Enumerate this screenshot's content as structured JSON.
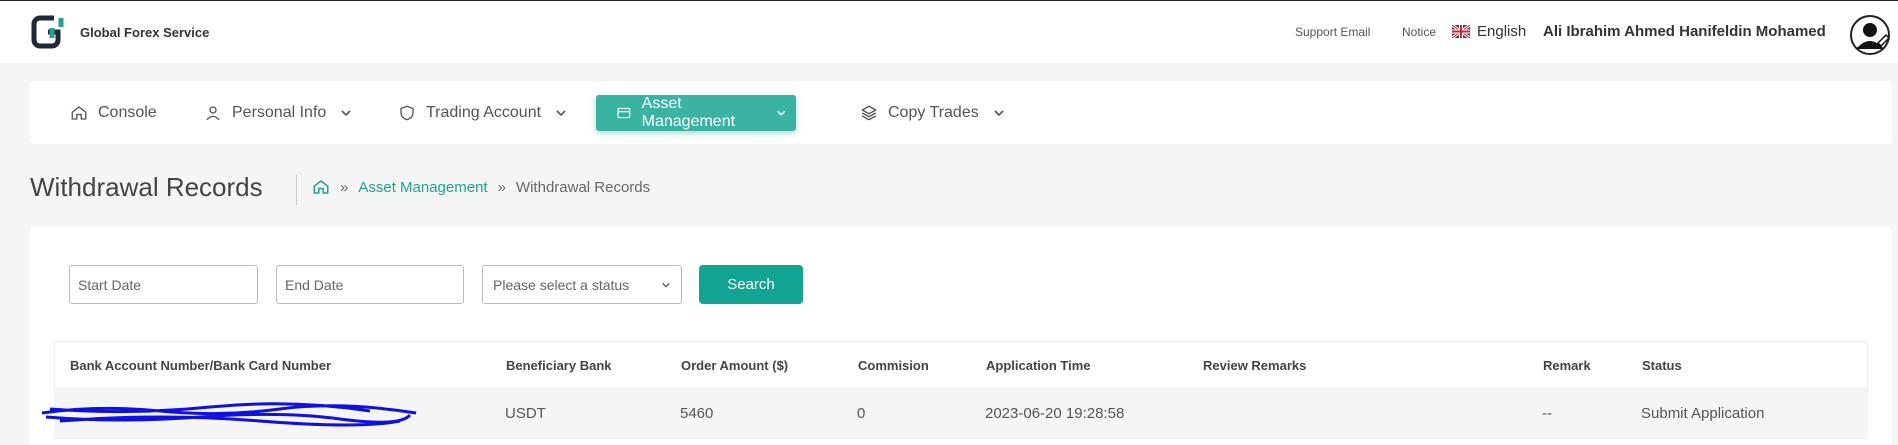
{
  "header": {
    "brand": "Global Forex Service",
    "support_email_label": "Support Email",
    "notice_label": "Notice",
    "language": "English",
    "user_name": "Ali Ibrahim Ahmed Hanifeldin Mohamed"
  },
  "nav": {
    "items": [
      {
        "label": "Console"
      },
      {
        "label": "Personal Info"
      },
      {
        "label": "Trading Account"
      },
      {
        "label": "Asset Management"
      },
      {
        "label": "Copy Trades"
      }
    ],
    "active_index": 3
  },
  "page": {
    "title": "Withdrawal Records",
    "breadcrumb": {
      "separator": "»",
      "parent": "Asset Management",
      "current": "Withdrawal Records"
    }
  },
  "filters": {
    "start_date_placeholder": "Start Date",
    "end_date_placeholder": "End Date",
    "status_placeholder": "Please select a status",
    "search_label": "Search"
  },
  "table": {
    "columns": [
      "Bank Account Number/Bank Card Number",
      "Beneficiary Bank",
      "Order Amount ($)",
      "Commision",
      "Application Time",
      "Review Remarks",
      "Remark",
      "Status"
    ],
    "rows": [
      {
        "account": "",
        "bank": "USDT",
        "amount": "5460",
        "commission": "0",
        "time": "2023-06-20 19:28:58",
        "review_remarks": "",
        "remark": "--",
        "status": "Submit Application"
      }
    ]
  },
  "colors": {
    "accent": "#3bb3a3",
    "button": "#12a493",
    "redaction": "#1010e0"
  }
}
